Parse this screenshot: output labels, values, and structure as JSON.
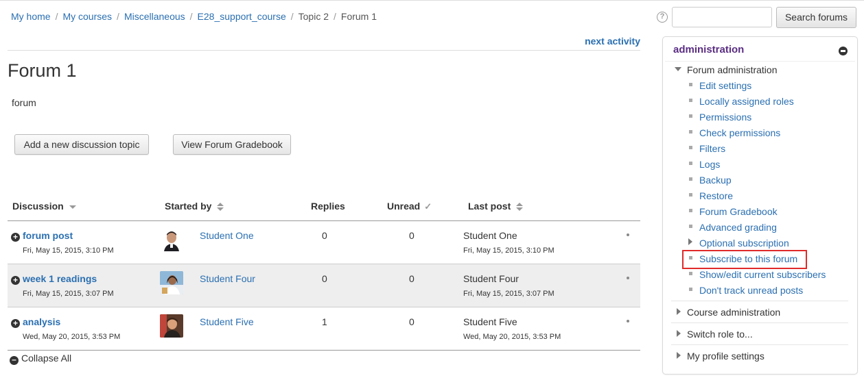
{
  "breadcrumb": {
    "items": [
      "My home",
      "My courses",
      "Miscellaneous",
      "E28_support_course",
      "Topic 2",
      "Forum 1"
    ],
    "separator": "/"
  },
  "search": {
    "help_icon": "?",
    "input_value": "",
    "button_label": "Search forums"
  },
  "nav": {
    "next_activity": "next activity"
  },
  "page": {
    "title": "Forum 1",
    "intro": "forum",
    "add_button": "Add a new discussion topic",
    "gradebook_button": "View Forum Gradebook"
  },
  "table": {
    "headers": {
      "discussion": "Discussion",
      "started_by": "Started by",
      "replies": "Replies",
      "unread": "Unread",
      "last_post": "Last post"
    },
    "rows": [
      {
        "title": "forum post",
        "date": "Fri, May 15, 2015, 3:10 PM",
        "starter": "Student One",
        "replies": "0",
        "unread": "0",
        "last_name": "Student One",
        "last_date": "Fri, May 15, 2015, 3:10 PM"
      },
      {
        "title": "week 1 readings",
        "date": "Fri, May 15, 2015, 3:07 PM",
        "starter": "Student Four",
        "replies": "0",
        "unread": "0",
        "last_name": "Student Four",
        "last_date": "Fri, May 15, 2015, 3:07 PM"
      },
      {
        "title": "analysis",
        "date": "Wed, May 20, 2015, 3:53 PM",
        "starter": "Student Five",
        "replies": "1",
        "unread": "0",
        "last_name": "Student Five",
        "last_date": "Wed, May 20, 2015, 3:53 PM"
      }
    ],
    "collapse_all": "Collapse All"
  },
  "admin": {
    "title": "administration",
    "forum_admin": "Forum administration",
    "items": [
      "Edit settings",
      "Locally assigned roles",
      "Permissions",
      "Check permissions",
      "Filters",
      "Logs",
      "Backup",
      "Restore",
      "Forum Gradebook",
      "Advanced grading",
      "Optional subscription",
      "Subscribe to this forum",
      "Show/edit current subscribers",
      "Don't track unread posts"
    ],
    "sections": [
      "Course administration",
      "Switch role to...",
      "My profile settings"
    ]
  },
  "colors": {
    "link": "#2a6fb1",
    "admin_title": "#5a2d82",
    "highlight": "#e02a2a",
    "row_shade": "#eeeeee"
  }
}
